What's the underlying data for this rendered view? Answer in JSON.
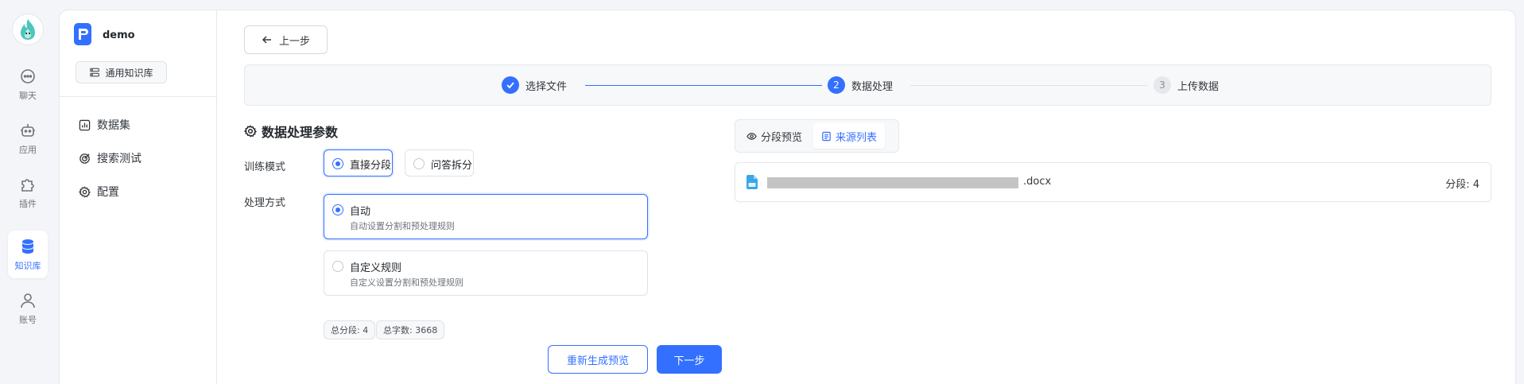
{
  "rail": {
    "items": [
      {
        "label": "聊天",
        "icon": "chat-icon"
      },
      {
        "label": "应用",
        "icon": "robot-icon"
      },
      {
        "label": "插件",
        "icon": "puzzle-icon"
      },
      {
        "label": "知识库",
        "icon": "database-icon"
      },
      {
        "label": "账号",
        "icon": "user-icon"
      }
    ]
  },
  "sidebar": {
    "app_name": "demo",
    "kb_type": "通用知识库",
    "items": [
      {
        "label": "数据集",
        "icon": "chart-icon"
      },
      {
        "label": "搜索测试",
        "icon": "target-icon"
      },
      {
        "label": "配置",
        "icon": "gear-icon"
      }
    ]
  },
  "back_label": "上一步",
  "steps": [
    {
      "num": "1",
      "label": "选择文件",
      "state": "done"
    },
    {
      "num": "2",
      "label": "数据处理",
      "state": "active"
    },
    {
      "num": "3",
      "label": "上传数据",
      "state": "todo"
    }
  ],
  "section_title": "数据处理参数",
  "training": {
    "label": "训练模式",
    "options": [
      {
        "label": "直接分段",
        "selected": true
      },
      {
        "label": "问答拆分",
        "selected": false
      }
    ]
  },
  "processing": {
    "label": "处理方式",
    "options": [
      {
        "label": "自动",
        "desc": "自动设置分割和预处理规则",
        "selected": true
      },
      {
        "label": "自定义规则",
        "desc": "自定义设置分割和预处理规则",
        "selected": false
      }
    ]
  },
  "stats": {
    "segments": "总分段: 4",
    "chars": "总字数: 3668"
  },
  "actions": {
    "regen": "重新生成预览",
    "next": "下一步"
  },
  "tabs": [
    {
      "label": "分段预览",
      "icon": "eye-icon",
      "active": false
    },
    {
      "label": "来源列表",
      "icon": "list-icon",
      "active": true
    }
  ],
  "file": {
    "ext": ".docx",
    "count": "分段: 4"
  },
  "colors": {
    "accent": "#3370ff",
    "border": "#e6e8ec"
  }
}
